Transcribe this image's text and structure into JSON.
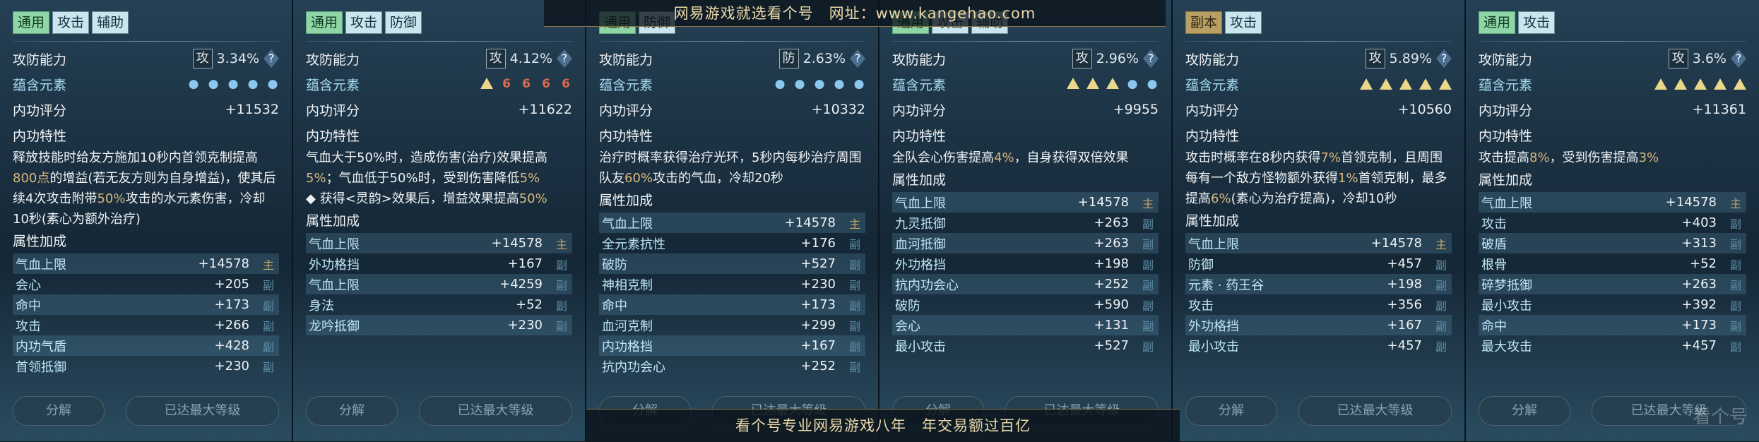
{
  "labels": {
    "atk_def": "攻防能力",
    "element": "蕴含元素",
    "score": "内功评分",
    "trait": "内功特性",
    "attr_title": "属性加成",
    "decompose": "分解",
    "max_level": "已达最大等级",
    "help": "?"
  },
  "panels": [
    {
      "tags": [
        {
          "text": "通用",
          "style": "green"
        },
        {
          "text": "攻击",
          "style": "plain"
        },
        {
          "text": "辅助",
          "style": "plain"
        }
      ],
      "atk_type": "攻",
      "atk_pct": "3.34%",
      "elements": [
        "water",
        "water",
        "water",
        "water",
        "water"
      ],
      "score": "+11532",
      "trait": [
        {
          "t": "释放技能时给友方施加10秒内首领克制提高"
        },
        {
          "t": "800点",
          "h": true
        },
        {
          "t": "的增益(若无友方则为自身增益)，使其后续4次攻击附带"
        },
        {
          "t": "50%",
          "h": true
        },
        {
          "t": "攻击的水元素伤害，冷却10秒(素心为额外治疗)"
        }
      ],
      "attrs": [
        {
          "name": "气血上限",
          "value": "+14578",
          "badge": "主"
        },
        {
          "name": "会心",
          "value": "+205",
          "badge": "副"
        },
        {
          "name": "命中",
          "value": "+173",
          "badge": "副"
        },
        {
          "name": "攻击",
          "value": "+266",
          "badge": "副"
        },
        {
          "name": "内功气盾",
          "value": "+428",
          "badge": "副"
        },
        {
          "name": "首领抵御",
          "value": "+230",
          "badge": "副"
        }
      ]
    },
    {
      "tags": [
        {
          "text": "通用",
          "style": "green"
        },
        {
          "text": "攻击",
          "style": "plain"
        },
        {
          "text": "防御",
          "style": "plain"
        }
      ],
      "atk_type": "攻",
      "atk_pct": "4.12%",
      "elements": [
        "tri",
        "fire",
        "fire",
        "fire",
        "fire"
      ],
      "score": "+11622",
      "trait": [
        {
          "t": "气血大于50%时，造成伤害(治疗)效果提高"
        },
        {
          "t": "5%",
          "h": true
        },
        {
          "t": "；气血低于50%时，受到伤害降低"
        },
        {
          "t": "5%",
          "h": true
        },
        {
          "t": "\n◆ 获得<灵韵>效果后，增益效果提高"
        },
        {
          "t": "50%",
          "h": true
        }
      ],
      "attrs": [
        {
          "name": "气血上限",
          "value": "+14578",
          "badge": "主"
        },
        {
          "name": "外功格挡",
          "value": "+167",
          "badge": "副"
        },
        {
          "name": "气血上限",
          "value": "+4259",
          "badge": "副"
        },
        {
          "name": "身法",
          "value": "+52",
          "badge": "副"
        },
        {
          "name": "龙吟抵御",
          "value": "+230",
          "badge": "副"
        }
      ]
    },
    {
      "tags": [
        {
          "text": "通用",
          "style": "green"
        },
        {
          "text": "防御",
          "style": "plain"
        }
      ],
      "atk_type": "防",
      "atk_pct": "2.63%",
      "elements": [
        "water",
        "water",
        "water",
        "water",
        "water"
      ],
      "score": "+10332",
      "trait": [
        {
          "t": "治疗时概率获得治疗光环，5秒内每秒治疗周围队友"
        },
        {
          "t": "60%",
          "h": true
        },
        {
          "t": "攻击的气血，冷却20秒"
        }
      ],
      "attrs": [
        {
          "name": "气血上限",
          "value": "+14578",
          "badge": "主"
        },
        {
          "name": "全元素抗性",
          "value": "+176",
          "badge": "副"
        },
        {
          "name": "破防",
          "value": "+527",
          "badge": "副"
        },
        {
          "name": "神相克制",
          "value": "+230",
          "badge": "副"
        },
        {
          "name": "命中",
          "value": "+173",
          "badge": "副"
        },
        {
          "name": "血河克制",
          "value": "+299",
          "badge": "副"
        },
        {
          "name": "内功格挡",
          "value": "+167",
          "badge": "副"
        },
        {
          "name": "抗内功会心",
          "value": "+252",
          "badge": "副"
        }
      ]
    },
    {
      "tags": [
        {
          "text": "通用",
          "style": "green"
        },
        {
          "text": "攻击",
          "style": "plain"
        },
        {
          "text": "辅助",
          "style": "plain"
        }
      ],
      "atk_type": "攻",
      "atk_pct": "2.96%",
      "elements": [
        "tri",
        "tri",
        "tri",
        "water",
        "water"
      ],
      "score": "+9955",
      "trait": [
        {
          "t": "全队会心伤害提高"
        },
        {
          "t": "4%",
          "h": true
        },
        {
          "t": "，自身获得双倍效果"
        }
      ],
      "attrs": [
        {
          "name": "气血上限",
          "value": "+14578",
          "badge": "主"
        },
        {
          "name": "九灵抵御",
          "value": "+263",
          "badge": "副"
        },
        {
          "name": "血河抵御",
          "value": "+263",
          "badge": "副"
        },
        {
          "name": "外功格挡",
          "value": "+198",
          "badge": "副"
        },
        {
          "name": "抗内功会心",
          "value": "+252",
          "badge": "副"
        },
        {
          "name": "破防",
          "value": "+590",
          "badge": "副"
        },
        {
          "name": "会心",
          "value": "+131",
          "badge": "副"
        },
        {
          "name": "最小攻击",
          "value": "+527",
          "badge": "副"
        }
      ]
    },
    {
      "tags": [
        {
          "text": "副本",
          "style": "gold"
        },
        {
          "text": "攻击",
          "style": "plain"
        }
      ],
      "atk_type": "攻",
      "atk_pct": "5.89%",
      "elements": [
        "tri",
        "tri",
        "tri",
        "tri",
        "tri"
      ],
      "score": "+10560",
      "trait": [
        {
          "t": "攻击时概率在8秒内获得"
        },
        {
          "t": "7%",
          "h": true
        },
        {
          "t": "首领克制，且周围每有一个敌方怪物额外获得"
        },
        {
          "t": "1%",
          "h": true
        },
        {
          "t": "首领克制，最多提高"
        },
        {
          "t": "6%",
          "h": true
        },
        {
          "t": "(素心为治疗提高)，冷却10秒"
        }
      ],
      "attrs": [
        {
          "name": "气血上限",
          "value": "+14578",
          "badge": "主"
        },
        {
          "name": "防御",
          "value": "+457",
          "badge": "副"
        },
        {
          "name": "元素 · 药王谷",
          "value": "+198",
          "badge": "副"
        },
        {
          "name": "攻击",
          "value": "+356",
          "badge": "副"
        },
        {
          "name": "外功格挡",
          "value": "+167",
          "badge": "副"
        },
        {
          "name": "最小攻击",
          "value": "+457",
          "badge": "副"
        }
      ]
    },
    {
      "tags": [
        {
          "text": "通用",
          "style": "green"
        },
        {
          "text": "攻击",
          "style": "plain"
        }
      ],
      "atk_type": "攻",
      "atk_pct": "3.6%",
      "elements": [
        "tri",
        "tri",
        "tri",
        "tri",
        "tri"
      ],
      "score": "+11361",
      "trait": [
        {
          "t": "攻击提高"
        },
        {
          "t": "8%",
          "h": true
        },
        {
          "t": "，受到伤害提高"
        },
        {
          "t": "3%",
          "h": true
        }
      ],
      "attrs": [
        {
          "name": "气血上限",
          "value": "+14578",
          "badge": "主"
        },
        {
          "name": "攻击",
          "value": "+403",
          "badge": "副"
        },
        {
          "name": "破盾",
          "value": "+313",
          "badge": "副"
        },
        {
          "name": "根骨",
          "value": "+52",
          "badge": "副"
        },
        {
          "name": "碎梦抵御",
          "value": "+263",
          "badge": "副"
        },
        {
          "name": "最小攻击",
          "value": "+392",
          "badge": "副"
        },
        {
          "name": "命中",
          "value": "+173",
          "badge": "副"
        },
        {
          "name": "最大攻击",
          "value": "+457",
          "badge": "副"
        }
      ]
    }
  ],
  "watermark_top": "网易游戏就选看个号　网址：www.kangehao.com",
  "watermark_bottom": "看个号专业网易游戏八年　年交易额过百亿",
  "watermark_logo": "看个号"
}
